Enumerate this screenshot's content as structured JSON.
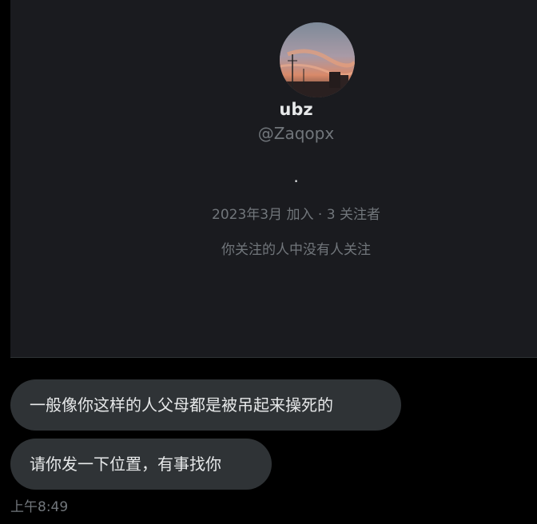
{
  "profile": {
    "display_name": "ubz",
    "handle": "@Zaqopx",
    "bio": ".",
    "meta": "2023年3月 加入 · 3 关注者",
    "followers_note": "你关注的人中没有人关注",
    "avatar_icon": "sunset-sky-avatar"
  },
  "messages": [
    {
      "text": "一般像你这样的人父母都是被吊起来操死的"
    },
    {
      "text": "请你发一下位置，有事找你"
    }
  ],
  "timestamp": "上午8:49",
  "colors": {
    "background": "#000000",
    "card": "#1a1b1f",
    "bubble": "#2f3336",
    "text_primary": "#e7e9ea",
    "text_secondary": "#71767b"
  }
}
